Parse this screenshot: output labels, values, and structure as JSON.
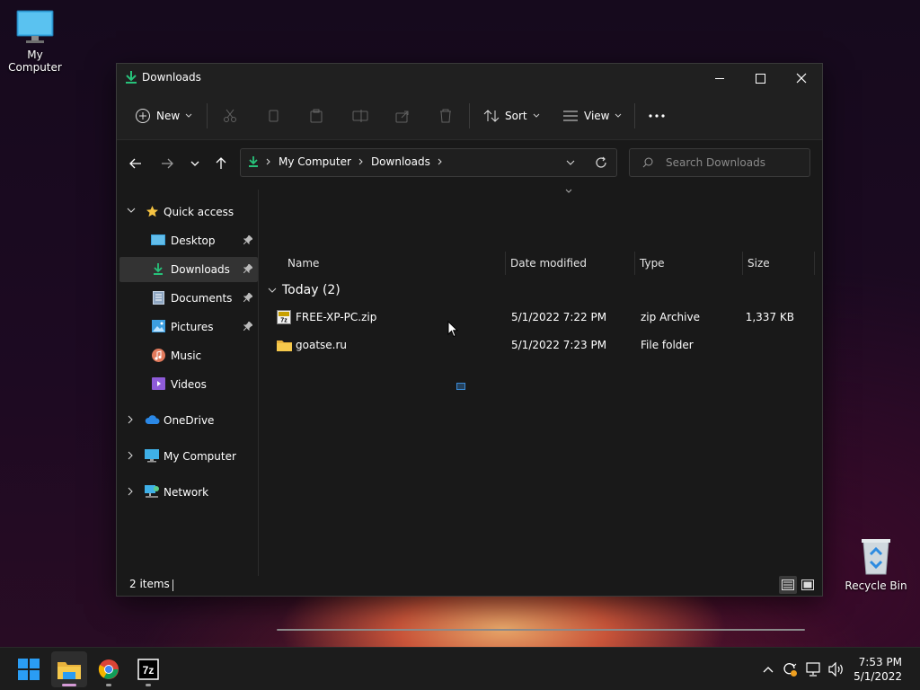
{
  "desktop": {
    "my_computer_label": "My Computer",
    "recycle_bin_label": "Recycle Bin"
  },
  "window": {
    "title": "Downloads",
    "toolbar": {
      "new_label": "New",
      "sort_label": "Sort",
      "view_label": "View"
    },
    "address": {
      "crumbs": [
        "My Computer",
        "Downloads"
      ]
    },
    "search": {
      "placeholder": "Search Downloads"
    },
    "sidebar": {
      "quick_access": "Quick access",
      "items": [
        {
          "label": "Desktop",
          "pinned": true
        },
        {
          "label": "Downloads",
          "pinned": true,
          "selected": true
        },
        {
          "label": "Documents",
          "pinned": true
        },
        {
          "label": "Pictures",
          "pinned": true
        },
        {
          "label": "Music",
          "pinned": false
        },
        {
          "label": "Videos",
          "pinned": false
        }
      ],
      "roots": [
        {
          "label": "OneDrive"
        },
        {
          "label": "My Computer"
        },
        {
          "label": "Network"
        }
      ]
    },
    "columns": {
      "name": "Name",
      "date": "Date modified",
      "type": "Type",
      "size": "Size"
    },
    "group": {
      "label": "Today (2)"
    },
    "files": [
      {
        "name": "FREE-XP-PC.zip",
        "date": "5/1/2022 7:22 PM",
        "type": "zip Archive",
        "size": "1,337 KB",
        "icon": "zip-icon"
      },
      {
        "name": "goatse.ru",
        "date": "5/1/2022 7:23 PM",
        "type": "File folder",
        "size": "",
        "icon": "folder-icon"
      }
    ],
    "status": {
      "count": "2 items"
    }
  },
  "taskbar": {
    "clock_time": "7:53 PM",
    "clock_date": "5/1/2022",
    "accent": "#0078d4"
  }
}
